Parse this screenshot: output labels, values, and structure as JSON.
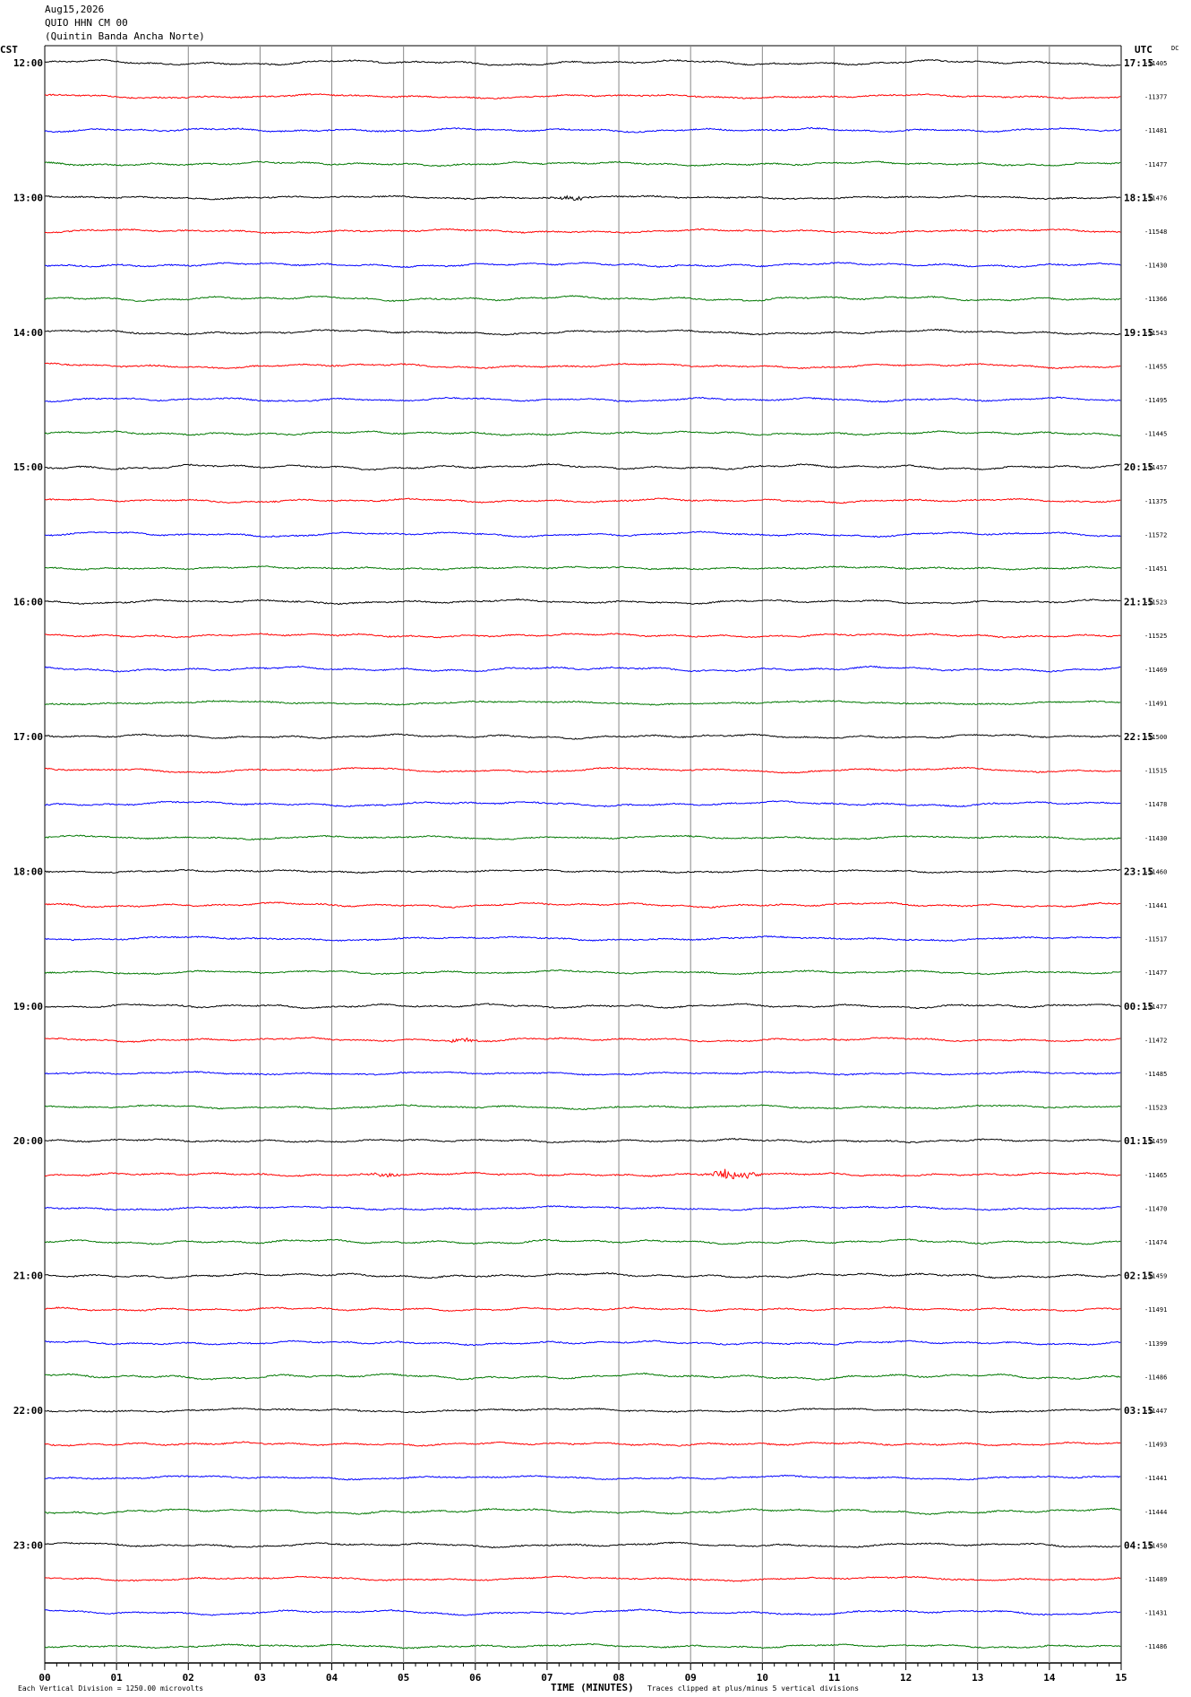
{
  "header": {
    "date": "Aug15,2026",
    "channel": "QUIO HHN CM 00",
    "station_name": "(Quintin Banda Ancha Norte)"
  },
  "left_axis_label": "CST",
  "right_axis_label": "UTC",
  "dc_label": "DC",
  "footer": {
    "scale_note": "Each Vertical Division = 1250.00 microvolts",
    "time_label": "TIME (MINUTES)",
    "clip_note": "Traces clipped at plus/minus 5 vertical divisions"
  },
  "chart_data": {
    "type": "line",
    "xlabel": "TIME (MINUTES)",
    "xlim": [
      0,
      15
    ],
    "x_ticks": [
      "00",
      "01",
      "02",
      "03",
      "04",
      "05",
      "06",
      "07",
      "08",
      "09",
      "10",
      "11",
      "12",
      "13",
      "14",
      "15"
    ],
    "line_minutes": 15,
    "trace_colors": [
      "#000000",
      "#ff0000",
      "#0000ff",
      "#007700"
    ],
    "left_hour_labels": [
      "12:00",
      "13:00",
      "14:00",
      "15:00",
      "16:00",
      "17:00",
      "18:00",
      "19:00",
      "20:00",
      "21:00",
      "22:00",
      "23:00"
    ],
    "right_hour_labels": [
      "17:15",
      "18:15",
      "19:15",
      "20:15",
      "21:15",
      "22:15",
      "23:15",
      "00:15",
      "01:15",
      "02:15",
      "03:15",
      "04:15"
    ],
    "dc_offsets": [
      "-11405",
      "-11377",
      "-11481",
      "-11477",
      "-11476",
      "-11548",
      "-11430",
      "-11366",
      "-11543",
      "-11455",
      "-11495",
      "-11445",
      "-11457",
      "-11375",
      "-11572",
      "-11451",
      "-11523",
      "-11525",
      "-11469",
      "-11491",
      "-11500",
      "-11515",
      "-11478",
      "-11430",
      "-11460",
      "-11441",
      "-11517",
      "-11477",
      "-11477",
      "-11472",
      "-11485",
      "-11523",
      "-11459",
      "-11465",
      "-11470",
      "-11474",
      "-11459",
      "-11491",
      "-11399",
      "-11486",
      "-11447",
      "-11493",
      "-11441",
      "-11444",
      "-11450",
      "-11489",
      "-11431",
      "-11486"
    ],
    "events": [
      {
        "trace": 4,
        "minute": 7.35,
        "amplitude": "small"
      },
      {
        "trace": 29,
        "minute": 5.8,
        "amplitude": "small"
      },
      {
        "trace": 33,
        "minute": 4.7,
        "amplitude": "small"
      },
      {
        "trace": 33,
        "minute": 9.6,
        "amplitude": "medium"
      }
    ]
  }
}
